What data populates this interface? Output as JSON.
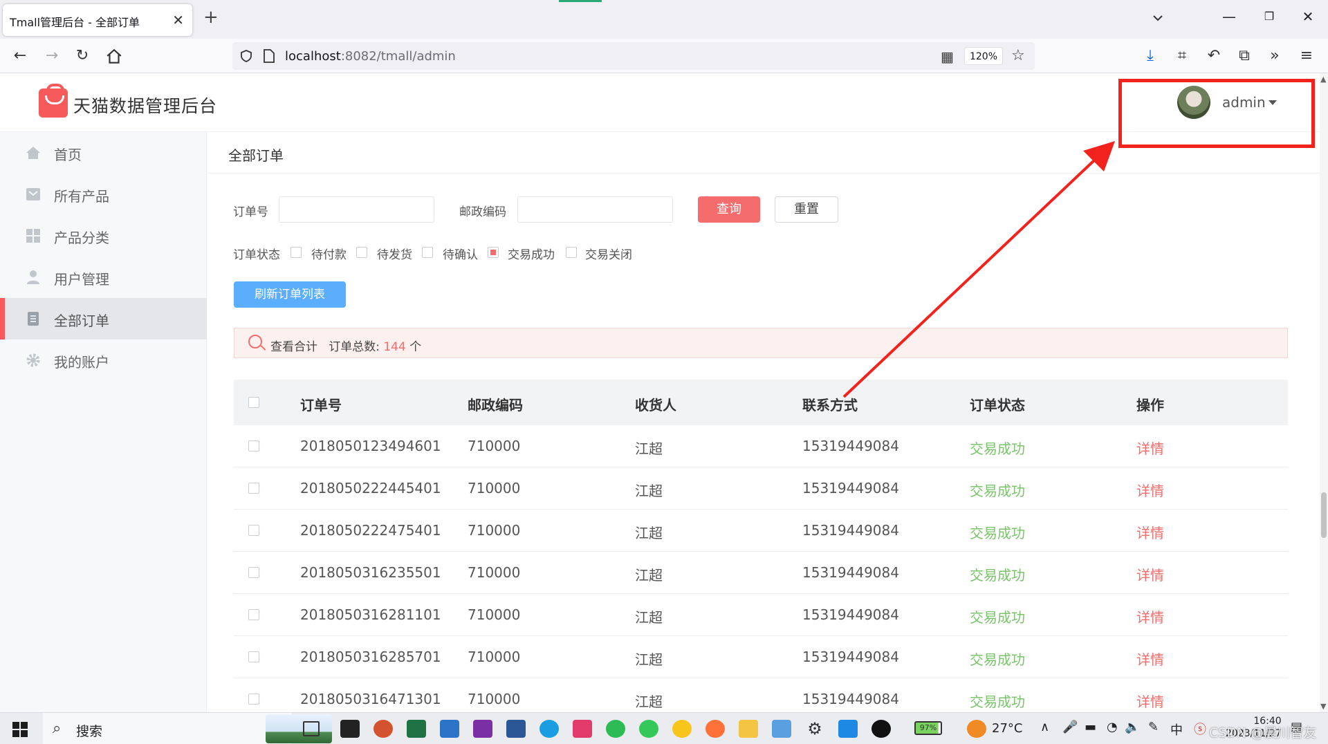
{
  "browser": {
    "tab_title": "Tmall管理后台 - 全部订单",
    "tab_close": "✕",
    "new_tab": "+",
    "url_host": "localhost",
    "url_rest": ":8082/tmall/admin",
    "zoom": "120%"
  },
  "app": {
    "title": "天猫数据管理后台",
    "user": "admin"
  },
  "sidebar": {
    "items": [
      {
        "label": "首页",
        "icon": "home-icon"
      },
      {
        "label": "所有产品",
        "icon": "product-icon"
      },
      {
        "label": "产品分类",
        "icon": "category-icon"
      },
      {
        "label": "用户管理",
        "icon": "user-icon"
      },
      {
        "label": "全部订单",
        "icon": "order-icon",
        "active": true
      },
      {
        "label": "我的账户",
        "icon": "gear-icon"
      }
    ]
  },
  "page": {
    "title": "全部订单",
    "filters": {
      "order_no_label": "订单号",
      "postcode_label": "邮政编码",
      "order_no_value": "",
      "postcode_value": "",
      "query_button": "查询",
      "reset_button": "重置",
      "status_label": "订单状态",
      "statuses": [
        {
          "label": "待付款",
          "checked": false
        },
        {
          "label": "待发货",
          "checked": false
        },
        {
          "label": "待确认",
          "checked": false
        },
        {
          "label": "交易成功",
          "checked": true
        },
        {
          "label": "交易关闭",
          "checked": false
        }
      ],
      "refresh_button": "刷新订单列表"
    },
    "summary": {
      "view_total": "查看合计",
      "total_label": "订单总数: ",
      "total_count": "144",
      "unit": " 个"
    },
    "table": {
      "columns": [
        "订单号",
        "邮政编码",
        "收货人",
        "联系方式",
        "订单状态",
        "操作"
      ],
      "rows": [
        {
          "order_no": "2018050123494601",
          "postcode": "710000",
          "receiver": "江超",
          "phone": "15319449084",
          "status": "交易成功",
          "action": "详情"
        },
        {
          "order_no": "2018050222445401",
          "postcode": "710000",
          "receiver": "江超",
          "phone": "15319449084",
          "status": "交易成功",
          "action": "详情"
        },
        {
          "order_no": "2018050222475401",
          "postcode": "710000",
          "receiver": "江超",
          "phone": "15319449084",
          "status": "交易成功",
          "action": "详情"
        },
        {
          "order_no": "2018050316235501",
          "postcode": "710000",
          "receiver": "江超",
          "phone": "15319449084",
          "status": "交易成功",
          "action": "详情"
        },
        {
          "order_no": "2018050316281101",
          "postcode": "710000",
          "receiver": "江超",
          "phone": "15319449084",
          "status": "交易成功",
          "action": "详情"
        },
        {
          "order_no": "2018050316285701",
          "postcode": "710000",
          "receiver": "江超",
          "phone": "15319449084",
          "status": "交易成功",
          "action": "详情"
        },
        {
          "order_no": "2018050316471301",
          "postcode": "710000",
          "receiver": "江超",
          "phone": "15319449084",
          "status": "交易成功",
          "action": "详情"
        }
      ]
    }
  },
  "taskbar": {
    "search": "搜索",
    "battery": "97%",
    "temperature": "27°C",
    "ime": "中",
    "time": "16:40",
    "date": "2023/11/27",
    "watermark": "CSDN @晨川智友"
  },
  "colors": {
    "accent_red": "#f56c6c",
    "success_green": "#7ac36b",
    "button_blue": "#5aaefc",
    "annotation_red": "#f2231d"
  }
}
